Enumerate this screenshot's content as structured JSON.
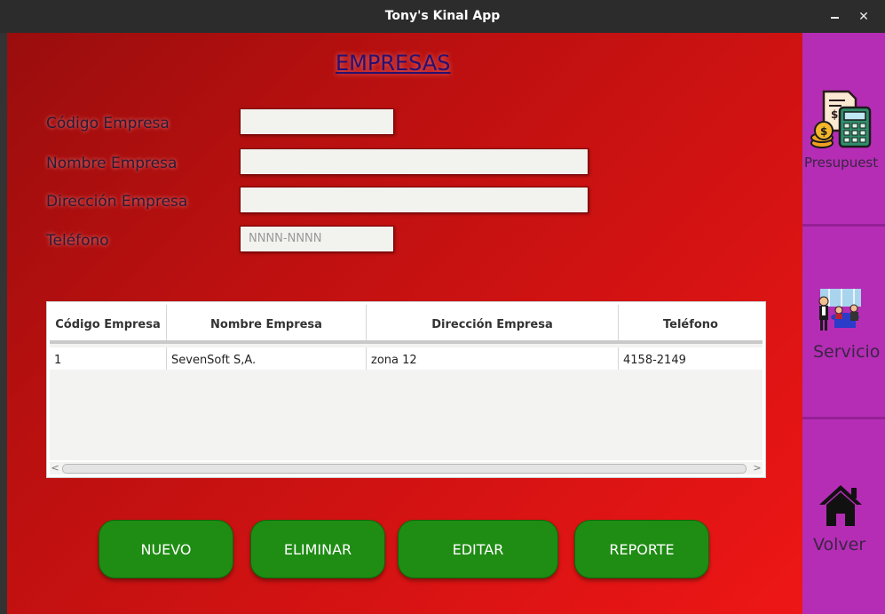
{
  "window": {
    "title": "Tony's Kinal App",
    "minimize_label": "",
    "close_label": "✕"
  },
  "page": {
    "heading": "EMPRESAS"
  },
  "form": {
    "codigo_label": "Código Empresa",
    "codigo_value": "",
    "nombre_label": "Nombre Empresa",
    "nombre_value": "",
    "direccion_label": "Dirección Empresa",
    "direccion_value": "",
    "telefono_label": "Teléfono",
    "telefono_placeholder": "NNNN-NNNN"
  },
  "table": {
    "columns": [
      "Código Empresa",
      "Nombre Empresa",
      "Dirección Empresa",
      "Teléfono"
    ],
    "rows": [
      [
        "1",
        "SevenSoft S,A.",
        "zona 12",
        "4158-2149"
      ]
    ],
    "scroll_left": "<",
    "scroll_right": ">"
  },
  "buttons": {
    "nuevo": "NUEVO",
    "eliminar": "ELIMINAR",
    "editar": "EDITAR",
    "reporte": "REPORTE"
  },
  "sidebar": {
    "items": [
      {
        "label": "Presupuest",
        "icon": "budget-calculator-icon"
      },
      {
        "label": "Servicio",
        "icon": "restaurant-service-icon"
      },
      {
        "label": "Volver",
        "icon": "home-icon"
      }
    ]
  },
  "colors": {
    "main_bg_start": "#9a0d0d",
    "main_bg_end": "#ee1616",
    "button_green": "#1f8c14",
    "sidebar_purple": "#b428b4",
    "heading_color": "#2a1070"
  }
}
